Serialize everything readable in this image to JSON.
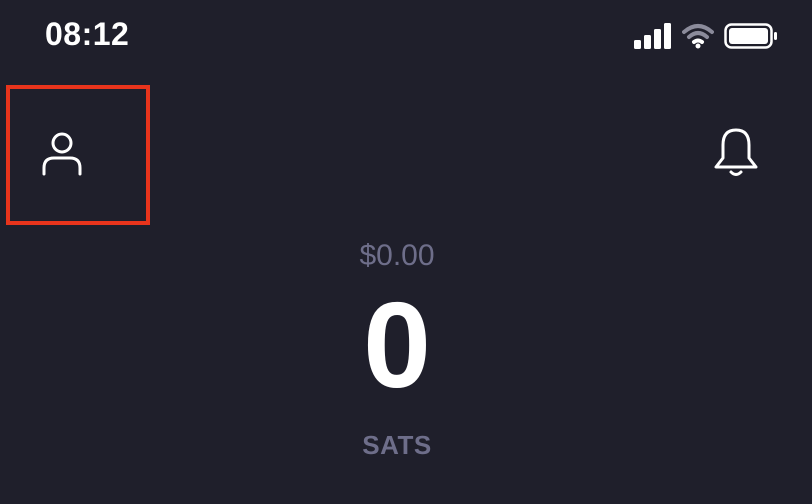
{
  "status_bar": {
    "time": "08:12",
    "icons": [
      "signal-icon",
      "wifi-icon",
      "battery-icon"
    ]
  },
  "header": {
    "profile_icon": "person-icon",
    "notifications_icon": "bell-icon"
  },
  "balance": {
    "fiat": "$0.00",
    "amount": "0",
    "unit": "SATS"
  },
  "colors": {
    "background": "#1f1f2b",
    "primary_text": "#ffffff",
    "secondary_text": "#6e6e8a",
    "highlight_border": "#e8341c"
  }
}
